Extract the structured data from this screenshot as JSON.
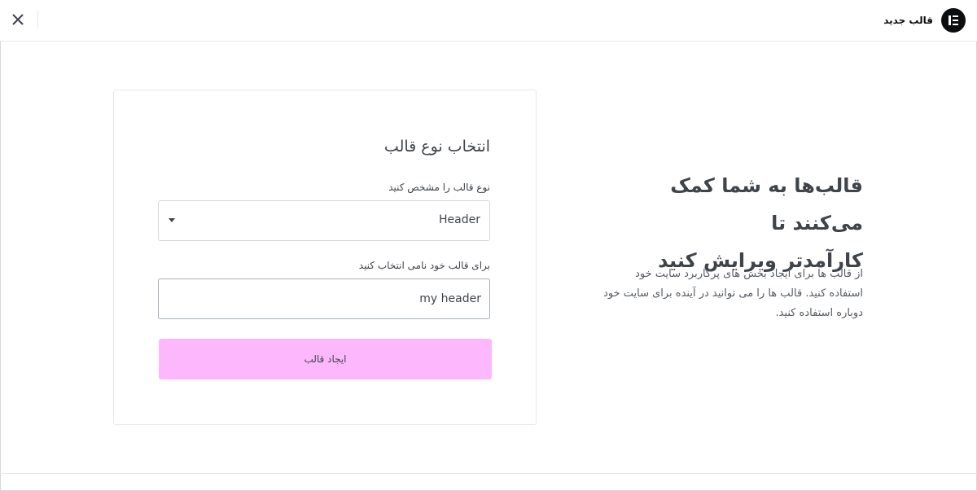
{
  "header": {
    "title": "قالب جدید",
    "logo_icon": "elementor-logo-icon",
    "close_icon": "close-icon"
  },
  "promo": {
    "headline_line1": "قالب‌ها به شما کمک می‌کنند تا",
    "headline_line2": "کارآمدتر ویرایش کنید",
    "description_line1": "از قالب ها برای ایجاد بخش های پرکاربرد سایت خود",
    "description_line2": "استفاده کنید. قالب ها را می توانید در آینده برای سایت خود",
    "description_line3": "دوباره استفاده کنید."
  },
  "form": {
    "title": "انتخاب نوع قالب",
    "type_label": "نوع قالب را مشخص کنید",
    "type_selected": "Header",
    "name_label": "برای قالب خود نامی انتخاب کنید",
    "name_value": "my header",
    "submit_label": "ایجاد قالب"
  },
  "colors": {
    "submit_button_bg": "#fdb8fd",
    "text": "#3f444b",
    "logo_bg": "#0c0d0e"
  }
}
